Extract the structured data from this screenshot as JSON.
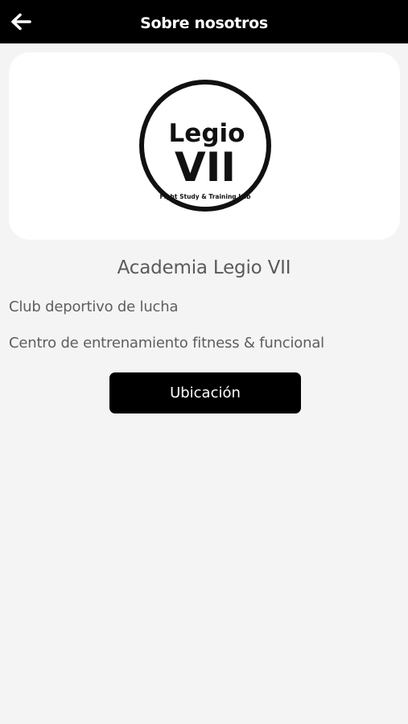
{
  "app_bar": {
    "title": "Sobre nosotros",
    "back_icon": "arrow-left-icon",
    "background": "#000000",
    "foreground": "#ffffff"
  },
  "logo": {
    "line1": "Legio",
    "line2": "VII",
    "tagline": "Fight Study & Training Lab"
  },
  "main": {
    "title": "Academia Legio VII",
    "descriptions": [
      "Club deportivo de lucha",
      "Centro de entrenamiento fitness & funcional"
    ],
    "location_button_label": "Ubicación"
  },
  "colors": {
    "page_background": "#f4f4f4",
    "card_background": "#ffffff",
    "text_gray": "#5a5a5a",
    "button_background": "#000000"
  }
}
